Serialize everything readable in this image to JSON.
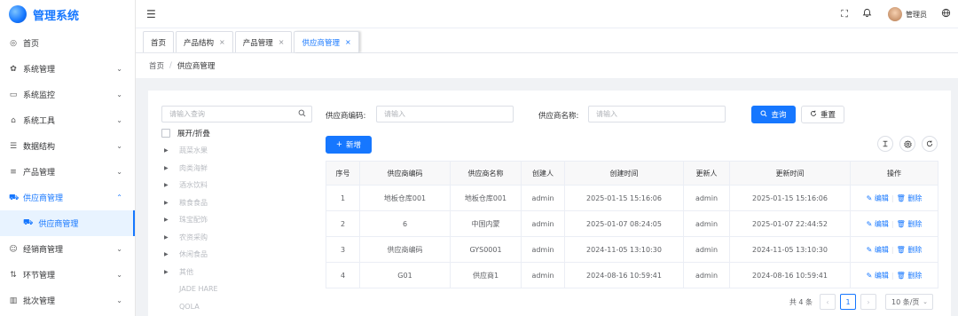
{
  "app": {
    "title": "管理系统"
  },
  "sidebar": {
    "items": [
      {
        "label": "首页",
        "icon": "dashboard-icon",
        "glyph": "◎"
      },
      {
        "label": "系统管理",
        "icon": "gear-icon",
        "glyph": "✿",
        "arrow": "⌄"
      },
      {
        "label": "系统监控",
        "icon": "monitor-icon",
        "glyph": "▭",
        "arrow": "⌄"
      },
      {
        "label": "系统工具",
        "icon": "toolbox-icon",
        "glyph": "⌂",
        "arrow": "⌄"
      },
      {
        "label": "数据结构",
        "icon": "sliders-icon",
        "glyph": "☰",
        "arrow": "⌄"
      },
      {
        "label": "产品管理",
        "icon": "list-icon",
        "glyph": "≡",
        "arrow": "⌄"
      },
      {
        "label": "供应商管理",
        "icon": "truck-icon",
        "glyph": "⛟",
        "arrow": "⌃",
        "open": true
      }
    ],
    "subitem": {
      "label": "供应商管理",
      "icon": "truck-icon",
      "glyph": "⛟"
    },
    "more_items": [
      {
        "label": "经销商管理",
        "icon": "users-icon",
        "glyph": "☺",
        "arrow": "⌄"
      },
      {
        "label": "环节管理",
        "icon": "flow-icon",
        "glyph": "⇅",
        "arrow": "⌄"
      },
      {
        "label": "批次管理",
        "icon": "barcode-icon",
        "glyph": "▥",
        "arrow": "⌄"
      }
    ]
  },
  "header": {
    "fold_glyph": "☰",
    "fullscreen_glyph": "⛶",
    "bell_glyph": "🔔",
    "user_name": "管理员",
    "language_glyph": "🌐"
  },
  "tabs": [
    {
      "label": "首页",
      "closable": false
    },
    {
      "label": "产品结构",
      "closable": true
    },
    {
      "label": "产品管理",
      "closable": true
    },
    {
      "label": "供应商管理",
      "closable": true,
      "active": true
    }
  ],
  "tab_close_glyph": "×",
  "breadcrumb": {
    "home": "首页",
    "separator": "/",
    "current": "供应商管理"
  },
  "tree": {
    "search_placeholder": "请输入查询",
    "toggle_label": "展开/折叠",
    "nodes": [
      {
        "label": "蔬菜水果",
        "expandable": true
      },
      {
        "label": "肉类海鲜",
        "expandable": true
      },
      {
        "label": "酒水饮料",
        "expandable": true
      },
      {
        "label": "粮食食品",
        "expandable": true
      },
      {
        "label": "珠宝配饰",
        "expandable": true
      },
      {
        "label": "农资采购",
        "expandable": true
      },
      {
        "label": "休闲食品",
        "expandable": true
      },
      {
        "label": "其他",
        "expandable": true
      },
      {
        "label": "JADE HARE",
        "expandable": false
      },
      {
        "label": "QOLA",
        "expandable": false
      }
    ]
  },
  "filters": {
    "code_label": "供应商编码:",
    "code_placeholder": "请输入",
    "name_label": "供应商名称:",
    "name_placeholder": "请输入",
    "search_button": "查询",
    "reset_button": "重置"
  },
  "toolbar": {
    "add_button": "新增"
  },
  "table": {
    "columns": [
      "序号",
      "供应商编码",
      "供应商名称",
      "创建人",
      "创建时间",
      "更新人",
      "更新时间",
      "操作"
    ],
    "rows": [
      [
        "1",
        "地板仓库001",
        "地板仓库001",
        "admin",
        "2025-01-15 15:16:06",
        "admin",
        "2025-01-15 15:16:06"
      ],
      [
        "2",
        "6",
        "中国内蒙",
        "admin",
        "2025-01-07 08:24:05",
        "admin",
        "2025-01-07 22:44:52"
      ],
      [
        "3",
        "供应商编码",
        "GYS0001",
        "admin",
        "2024-11-05 13:10:30",
        "admin",
        "2024-11-05 13:10:30"
      ],
      [
        "4",
        "G01",
        "供应商1",
        "admin",
        "2024-08-16 10:59:41",
        "admin",
        "2024-08-16 10:59:41"
      ]
    ],
    "edit_label": "编辑",
    "delete_label": "删除"
  },
  "pagination": {
    "total": "共 4 条",
    "current_page": "1",
    "page_size": "10 条/页"
  },
  "colors": {
    "primary": "#1677ff",
    "border": "#dcdfe6"
  }
}
